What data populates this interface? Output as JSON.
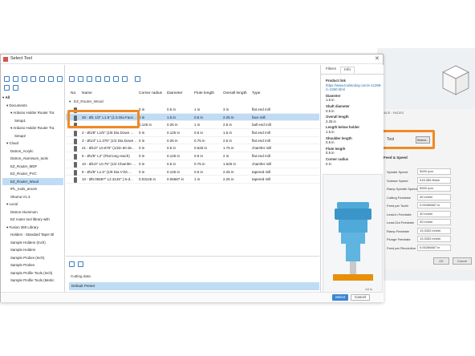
{
  "dialog": {
    "title": "Select Tool",
    "select_label": "Select",
    "cancel_label": "Cancel"
  },
  "library_tree": [
    {
      "label": "All",
      "depth": 0,
      "chevron": "▾",
      "bold": true
    },
    {
      "label": "Documents",
      "depth": 1,
      "chevron": "▾",
      "bold": false
    },
    {
      "label": "Arduino Holder Router Tra",
      "depth": 2,
      "chevron": "▾",
      "bold": false
    },
    {
      "label": "Setup1",
      "depth": 3,
      "chevron": "",
      "bold": false
    },
    {
      "label": "Arduino Holder Router Tra",
      "depth": 2,
      "chevron": "▾",
      "bold": false
    },
    {
      "label": "Setup2",
      "depth": 3,
      "chevron": "",
      "bold": false
    },
    {
      "label": "Cloud",
      "depth": 1,
      "chevron": "▾",
      "bold": false
    },
    {
      "label": "Datron_Acrylic",
      "depth": 2,
      "chevron": "",
      "bold": false
    },
    {
      "label": "Datron_Aluminum_tools",
      "depth": 2,
      "chevron": "",
      "bold": false
    },
    {
      "label": "EZ_Router_MDF",
      "depth": 2,
      "chevron": "",
      "bold": false
    },
    {
      "label": "EZ_Router_PVC",
      "depth": 2,
      "chevron": "",
      "bold": false
    },
    {
      "label": "EZ_Router_Wood",
      "depth": 2,
      "chevron": "",
      "bold": false,
      "selected": true
    },
    {
      "label": "IPL_tools_aroom",
      "depth": 2,
      "chevron": "",
      "bold": false
    },
    {
      "label": "Okuma V1.3",
      "depth": 2,
      "chevron": "",
      "bold": false
    },
    {
      "label": "Local",
      "depth": 1,
      "chevron": "▾",
      "bold": false
    },
    {
      "label": "Datron Aluminum",
      "depth": 2,
      "chevron": "",
      "bold": false
    },
    {
      "label": "EZ router tool library with ",
      "depth": 2,
      "chevron": "",
      "bold": false
    },
    {
      "label": "Fusion 360 Library",
      "depth": 1,
      "chevron": "▾",
      "bold": false
    },
    {
      "label": "Holders - Standard Taper Bl",
      "depth": 2,
      "chevron": "",
      "bold": false
    },
    {
      "label": "Sample Holders (Inch)",
      "depth": 2,
      "chevron": "",
      "bold": false
    },
    {
      "label": "Sample Holders",
      "depth": 2,
      "chevron": "",
      "bold": false
    },
    {
      "label": "Sample Probes (Inch)",
      "depth": 2,
      "chevron": "",
      "bold": false
    },
    {
      "label": "Sample Probes",
      "depth": 2,
      "chevron": "",
      "bold": false
    },
    {
      "label": "Sample Profile Tools (Inch)",
      "depth": 2,
      "chevron": "",
      "bold": false
    },
    {
      "label": "Sample Profile Tools (Metric",
      "depth": 2,
      "chevron": "",
      "bold": false
    }
  ],
  "tool_table": {
    "group_label": "EZ_Router_Wood",
    "columns": {
      "number": "No.",
      "name": "Name",
      "corner_radius": "Corner radius",
      "diameter": "Diameter",
      "flute_length": "Flute length",
      "overall_length": "Overall length",
      "type": "Type"
    },
    "rows": [
      {
        "number": "",
        "name": "",
        "corner_radius": "0 in",
        "diameter": "0.5 in",
        "flute_length": "1 in",
        "overall_length": "3 in",
        "type": "flat end mill",
        "selected": false
      },
      {
        "number": "",
        "name": "30 - Ø1 1/2\" L1.5\" (1.5 Dia Face ...",
        "corner_radius": "0 in",
        "diameter": "1.5 in",
        "flute_length": "0.5 in",
        "overall_length": "2.25 in",
        "type": "face mill",
        "selected": true
      },
      {
        "number": "",
        "name": "",
        "corner_radius": "0.125 in",
        "diameter": "0.25 in",
        "flute_length": "1 in",
        "overall_length": "2.5 in",
        "type": "ball end mill",
        "selected": false
      },
      {
        "number": "",
        "name": "4 - Ø1/8\" L1/5\" (1/8 Dia Down ...",
        "corner_radius": "0 in",
        "diameter": "0.125 in",
        "flute_length": "0.5 in",
        "overall_length": "1.5 in",
        "type": "flat end mill",
        "selected": false
      },
      {
        "number": "",
        "name": "3 - Ø1/4\" L1.375\" (1/4 Dia Down ...",
        "corner_radius": "0 in",
        "diameter": "0.25 in",
        "flute_length": "0.75 in",
        "overall_length": "2.5 in",
        "type": "flat end mill",
        "selected": false
      },
      {
        "number": "",
        "name": "21 - Ø1/2\" L0.875\" (1/2in 60 de...",
        "corner_radius": "0 in",
        "diameter": "0.5 in",
        "flute_length": "0.625 in",
        "overall_length": "1.75 in",
        "type": "chamfer mill",
        "selected": false
      },
      {
        "number": "",
        "name": "5 - Ø1/8\" L2\" (Flat long reach)",
        "corner_radius": "0 in",
        "diameter": "0.125 in",
        "flute_length": "0.5 in",
        "overall_length": "2 in",
        "type": "flat end mill",
        "selected": false
      },
      {
        "number": "",
        "name": "10 - Ø1/2\" L0.75\" (1/2 Chamfer ...",
        "corner_radius": "0 in",
        "diameter": "0.5 in",
        "flute_length": "0.75 in",
        "overall_length": "1.625 in",
        "type": "chamfer mill",
        "selected": false
      },
      {
        "number": "",
        "name": "8 - Ø1/8\" L1.5\" (1/8 Dia V-bit ...",
        "corner_radius": "0 in",
        "diameter": "0.125 in",
        "flute_length": "0.5 in",
        "overall_length": "2.25 in",
        "type": "tapered mill",
        "selected": false
      },
      {
        "number": "",
        "name": "10 - Ø0.05687\" L2.3125\" (.5-d...",
        "corner_radius": "0.03125 in",
        "diameter": "0.05687 in",
        "flute_length": "1 in",
        "overall_length": "2.25 in",
        "type": "tapered mill",
        "selected": false
      }
    ]
  },
  "cutting_data": {
    "title": "Cutting data",
    "preset": "Default Preset"
  },
  "right_tabs": [
    "Filters",
    "Info"
  ],
  "info": [
    {
      "label": "Product link",
      "value": "https://www.toolstoday.com/v-11399-rc-2250.html",
      "link": true
    },
    {
      "label": "Diameter",
      "value": "1.5 in"
    },
    {
      "label": "Shaft diameter",
      "value": "0.5 in"
    },
    {
      "label": "Overall length",
      "value": "2.25 in"
    },
    {
      "label": "Length below holder",
      "value": "1.5 in"
    },
    {
      "label": "Shoulder length",
      "value": "0.5 in"
    },
    {
      "label": "Flute length",
      "value": "0.5 in"
    },
    {
      "label": "Corner radius",
      "value": "0 in"
    }
  ],
  "preview": {
    "scale_label": "1/4 in",
    "colors": {
      "holder": "#4fa9d9",
      "shaft": "#c9c9c9",
      "cutter": "#e8900a"
    }
  },
  "bg_app": {
    "tabs": "FACE : FACES",
    "tool_label": "Tool",
    "select_button": "Select...",
    "section": "Feed & Speed",
    "fields": [
      {
        "label": "Spindle Speed",
        "value": "5000 rpm"
      },
      {
        "label": "Surface Speed",
        "value": "015.355 ft/min"
      },
      {
        "label": "Ramp Spindle Speed",
        "value": "5000 rpm"
      },
      {
        "label": "Cutting Feedrate",
        "value": "40 in/min"
      },
      {
        "label": "Feed per Tooth",
        "value": "0.00266667 in"
      },
      {
        "label": "Lead-In Feedrate",
        "value": "40 in/min"
      },
      {
        "label": "Lead-Out Feedrate",
        "value": "40 in/min"
      },
      {
        "label": "Ramp Feedrate",
        "value": "13.3333 in/min"
      },
      {
        "label": "Plunge Feedrate",
        "value": "13.3333 in/min"
      },
      {
        "label": "Feed per Revolution",
        "value": "0.00266667 in"
      }
    ],
    "ok_label": "OK",
    "cancel_label": "Cancel"
  },
  "accent_colors": {
    "highlight": "#f08a24",
    "selection": "#bfdcf5",
    "primary": "#3a86d4"
  }
}
